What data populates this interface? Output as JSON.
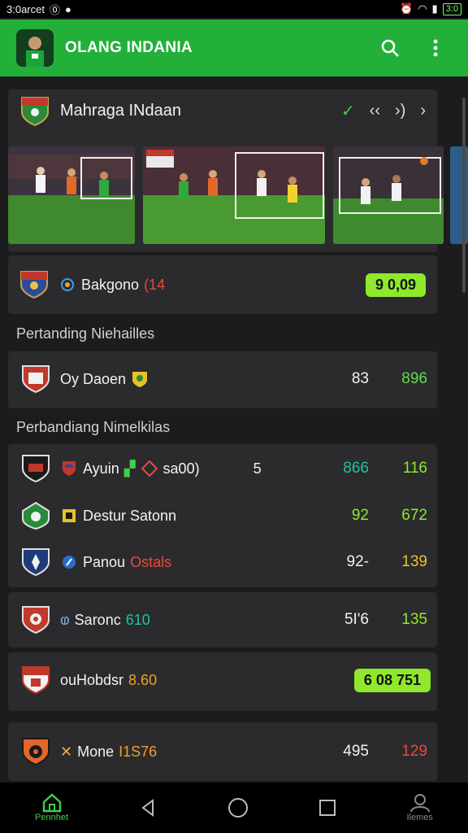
{
  "status": {
    "left_text": "3:0arcet",
    "battery": "3:0"
  },
  "header": {
    "title": "OLANG INDANIA"
  },
  "league": {
    "name": "Mahraga INdaan"
  },
  "featured": {
    "team": "Bakgono",
    "badge_text": "(14",
    "score": "9 0,09"
  },
  "sections": [
    {
      "title": "Pertanding Niehailles"
    },
    {
      "title": "Perbandiang Nimelkilas"
    }
  ],
  "match_single": {
    "team": "Oy Daoen",
    "s1": "83",
    "s2": "896"
  },
  "matches": [
    {
      "team": "Ayuin",
      "extra": "sa00)",
      "mid": "5",
      "s1": "866",
      "s2": "116"
    },
    {
      "team": "Destur Satonn",
      "extra": "",
      "mid": "",
      "s1": "92",
      "s2": "672"
    },
    {
      "team": "Panou",
      "extra": "Ostals",
      "mid": "",
      "s1": "92-",
      "s2": "139"
    }
  ],
  "card_rows": [
    {
      "team": "Saronc",
      "extra": "610",
      "s1": "5I'6",
      "s2": "135"
    },
    {
      "team": "ouHobdsr",
      "extra": "8.60",
      "pill": "6 08 751"
    },
    {
      "team": "Mone",
      "extra": "I1S76",
      "s1": "495",
      "s2": "129"
    }
  ],
  "nav": {
    "home_label": "Pennhet",
    "profile_label": "Ilemes"
  },
  "colors": {
    "brand_green": "#22b03a",
    "pill_green": "#8fe82c"
  }
}
